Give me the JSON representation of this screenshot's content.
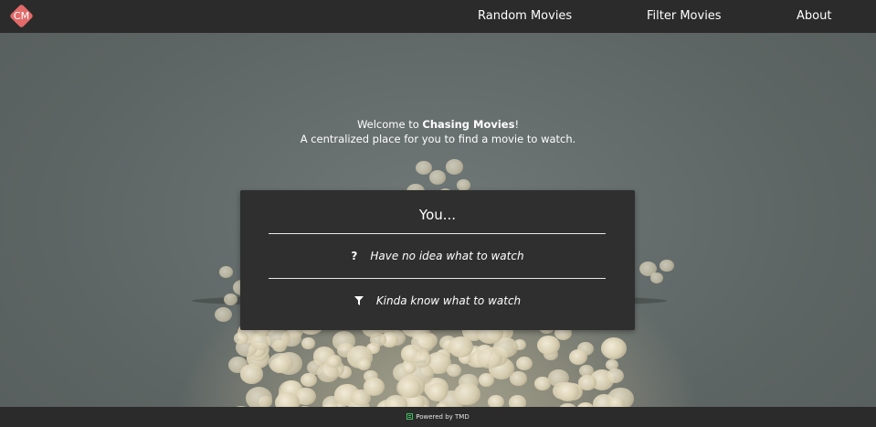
{
  "logo": {
    "text": "CM",
    "color": "#e36a6a"
  },
  "nav": {
    "random_label": "Random Movies",
    "filter_label": "Filter Movies",
    "about_label": "About"
  },
  "welcome": {
    "prefix": "Welcome to ",
    "brand": "Chasing Movies",
    "suffix": "!",
    "tagline": "A centralized place for you to find a movie to watch."
  },
  "card": {
    "title": "You...",
    "options": [
      {
        "icon": "question-icon",
        "glyph": "?",
        "label": "Have no idea what to watch"
      },
      {
        "icon": "filter-icon",
        "label": "Kinda know what to watch"
      }
    ]
  },
  "footer": {
    "icon": "tmdb-icon",
    "text": "Powered by TMD"
  },
  "colors": {
    "navbar": "#2b2b2b",
    "card": "#2f2f2f",
    "tmdb_green": "#3fbf5f"
  }
}
